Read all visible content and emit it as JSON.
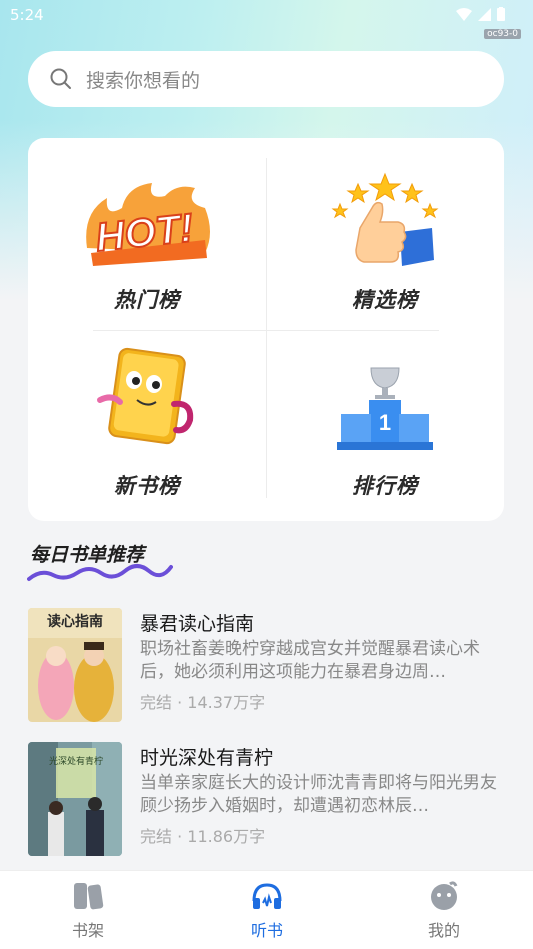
{
  "status": {
    "time": "5:24",
    "tag": "oc93-0"
  },
  "search": {
    "placeholder": "搜索你想看的"
  },
  "rankings": [
    {
      "label": "热门榜",
      "art_text": "HOT!"
    },
    {
      "label": "精选榜"
    },
    {
      "label": "新书榜"
    },
    {
      "label": "排行榜",
      "art_text": "1"
    }
  ],
  "section": {
    "title": "每日书单推荐"
  },
  "books": [
    {
      "title": "暴君读心指南",
      "desc": "职场社畜姜晚柠穿越成宫女并觉醒暴君读心术后，她必须利用这项能力在暴君身边周…",
      "status": "完结",
      "words": "14.37万字",
      "cover_text": "读心指南"
    },
    {
      "title": "时光深处有青柠",
      "desc": "当单亲家庭长大的设计师沈青青即将与阳光男友顾少扬步入婚姻时，却遭遇初恋林辰…",
      "status": "完结",
      "words": "11.86万字",
      "cover_text": "光深处有青柠"
    }
  ],
  "tabs": [
    {
      "label": "书架",
      "icon": "bookshelf-icon",
      "active": false
    },
    {
      "label": "听书",
      "icon": "headphones-icon",
      "active": true
    },
    {
      "label": "我的",
      "icon": "profile-icon",
      "active": false
    }
  ],
  "colors": {
    "accent": "#1e6de0",
    "hot": "#f26b21",
    "podium": "#3a8ef0"
  }
}
